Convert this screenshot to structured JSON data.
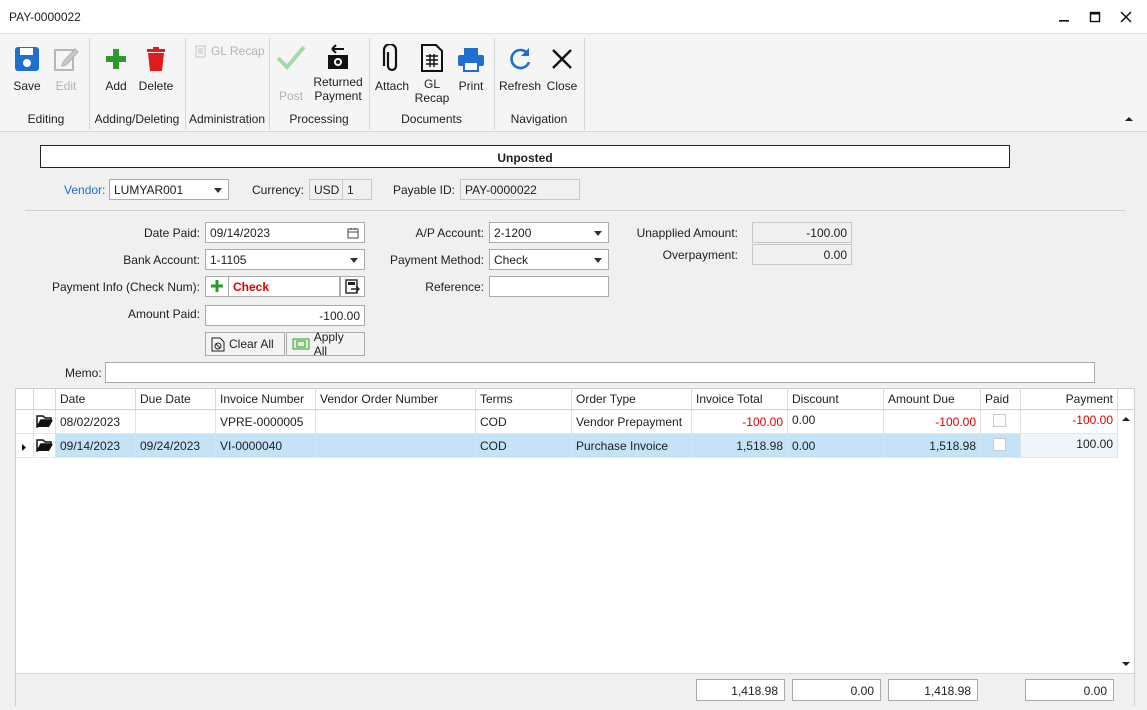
{
  "window": {
    "title": "PAY-0000022"
  },
  "ribbon": {
    "save": "Save",
    "edit": "Edit",
    "add": "Add",
    "delete": "Delete",
    "gl_recap_admin": "GL Recap",
    "post": "Post",
    "returned_payment_1": "Returned",
    "returned_payment_2": "Payment",
    "attach": "Attach",
    "gl_recap_1": "GL",
    "gl_recap_2": "Recap",
    "print": "Print",
    "refresh": "Refresh",
    "close": "Close",
    "groups": {
      "editing": "Editing",
      "adding_deleting": "Adding/Deleting",
      "administration": "Administration",
      "processing": "Processing",
      "documents": "Documents",
      "navigation": "Navigation"
    }
  },
  "status": "Unposted",
  "header": {
    "vendor_label": "Vendor:",
    "vendor_value": "LUMYAR001",
    "currency_label": "Currency:",
    "currency_code": "USD",
    "currency_rate": "1",
    "payable_id_label": "Payable ID:",
    "payable_id_value": "PAY-0000022"
  },
  "form": {
    "date_paid_label": "Date Paid:",
    "date_paid_value": "09/14/2023",
    "bank_account_label": "Bank Account:",
    "bank_account_value": "1-1105",
    "payment_info_label": "Payment Info (Check Num):",
    "payment_info_value": "Check",
    "amount_paid_label": "Amount Paid:",
    "amount_paid_value": "-100.00",
    "clear_all": "Clear All",
    "apply_all": "Apply All",
    "ap_account_label": "A/P Account:",
    "ap_account_value": "2-1200",
    "payment_method_label": "Payment Method:",
    "payment_method_value": "Check",
    "reference_label": "Reference:",
    "reference_value": "",
    "unapplied_label": "Unapplied Amount:",
    "unapplied_value": "-100.00",
    "overpayment_label": "Overpayment:",
    "overpayment_value": "0.00",
    "memo_label": "Memo:",
    "memo_value": ""
  },
  "grid": {
    "columns": [
      "Date",
      "Due Date",
      "Invoice Number",
      "Vendor Order Number",
      "Terms",
      "Order Type",
      "Invoice Total",
      "Discount",
      "Amount Due",
      "Paid",
      "Payment"
    ],
    "rows": [
      {
        "date": "08/02/2023",
        "due_date": "",
        "invoice_number": "VPRE-0000005",
        "vendor_order_number": "",
        "terms": "COD",
        "order_type": "Vendor Prepayment",
        "invoice_total": "-100.00",
        "discount": "0.00",
        "amount_due": "-100.00",
        "paid": false,
        "payment": "-100.00"
      },
      {
        "date": "09/14/2023",
        "due_date": "09/24/2023",
        "invoice_number": "VI-0000040",
        "vendor_order_number": "",
        "terms": "COD",
        "order_type": "Purchase Invoice",
        "invoice_total": "1,518.98",
        "discount": "0.00",
        "amount_due": "1,518.98",
        "paid": false,
        "payment": "100.00"
      }
    ],
    "totals": {
      "invoice_total": "1,418.98",
      "discount": "0.00",
      "amount_due": "1,418.98",
      "payment": "0.00"
    }
  },
  "colors": {
    "accent_blue": "#1f6fd1",
    "negative": "#e00000",
    "selected_row": "#c5e3f7",
    "add_green": "#2e9a2e",
    "delete_red": "#e01b1b"
  }
}
